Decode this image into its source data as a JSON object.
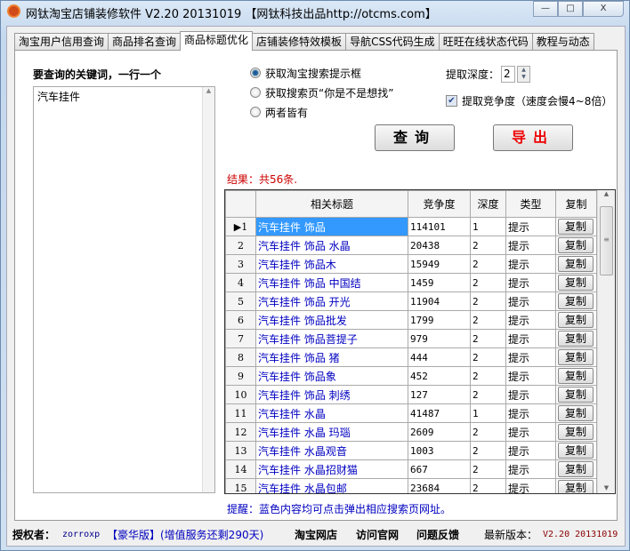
{
  "window": {
    "title": "网钛淘宝店铺装修软件 V2.20 20131019 【网钛科技出品http://otcms.com】",
    "min": "—",
    "max": "□",
    "close": "X"
  },
  "tabs": [
    "淘宝用户信用查询",
    "商品排名查询",
    "商品标题优化",
    "店铺装修特效模板",
    "导航CSS代码生成",
    "旺旺在线状态代码",
    "教程与动态"
  ],
  "left": {
    "label": "要查询的关键词，一行一个",
    "value": "汽车挂件"
  },
  "options": {
    "radios": [
      "获取淘宝搜索提示框",
      "获取搜索页“你是不是想找”",
      "两者皆有"
    ],
    "selected": 0,
    "depth_label": "提取深度：",
    "depth": "2",
    "check_label": "提取竞争度（速度会慢4~8倍）",
    "checked": true
  },
  "buttons": {
    "query": "查询",
    "export": "导出"
  },
  "result": "结果：共56条.",
  "grid": {
    "headers": [
      "相关标题",
      "竞争度",
      "深度",
      "类型",
      "复制"
    ],
    "rows": [
      {
        "n": "1",
        "title": "汽车挂件 饰品",
        "comp": "114101",
        "depth": "1",
        "type": "提示",
        "copy": "复制"
      },
      {
        "n": "2",
        "title": "汽车挂件 饰品 水晶",
        "comp": "20438",
        "depth": "2",
        "type": "提示",
        "copy": "复制"
      },
      {
        "n": "3",
        "title": "汽车挂件 饰品木",
        "comp": "15949",
        "depth": "2",
        "type": "提示",
        "copy": "复制"
      },
      {
        "n": "4",
        "title": "汽车挂件 饰品 中国结",
        "comp": "1459",
        "depth": "2",
        "type": "提示",
        "copy": "复制"
      },
      {
        "n": "5",
        "title": "汽车挂件 饰品 开光",
        "comp": "11904",
        "depth": "2",
        "type": "提示",
        "copy": "复制"
      },
      {
        "n": "6",
        "title": "汽车挂件 饰品批发",
        "comp": "1799",
        "depth": "2",
        "type": "提示",
        "copy": "复制"
      },
      {
        "n": "7",
        "title": "汽车挂件 饰品菩提子",
        "comp": "979",
        "depth": "2",
        "type": "提示",
        "copy": "复制"
      },
      {
        "n": "8",
        "title": "汽车挂件 饰品 猪",
        "comp": "444",
        "depth": "2",
        "type": "提示",
        "copy": "复制"
      },
      {
        "n": "9",
        "title": "汽车挂件 饰品象",
        "comp": "452",
        "depth": "2",
        "type": "提示",
        "copy": "复制"
      },
      {
        "n": "10",
        "title": "汽车挂件 饰品 刺绣",
        "comp": "127",
        "depth": "2",
        "type": "提示",
        "copy": "复制"
      },
      {
        "n": "11",
        "title": "汽车挂件 水晶",
        "comp": "41487",
        "depth": "1",
        "type": "提示",
        "copy": "复制"
      },
      {
        "n": "12",
        "title": "汽车挂件 水晶 玛瑙",
        "comp": "2609",
        "depth": "2",
        "type": "提示",
        "copy": "复制"
      },
      {
        "n": "13",
        "title": "汽车挂件 水晶观音",
        "comp": "1003",
        "depth": "2",
        "type": "提示",
        "copy": "复制"
      },
      {
        "n": "14",
        "title": "汽车挂件 水晶招财猫",
        "comp": "667",
        "depth": "2",
        "type": "提示",
        "copy": "复制"
      },
      {
        "n": "15",
        "title": "汽车挂件 水晶包邮",
        "comp": "23684",
        "depth": "2",
        "type": "提示",
        "copy": "复制"
      }
    ]
  },
  "hint": "提醒：蓝色内容均可点击弹出相应搜索页网址。",
  "footer": {
    "auth_label": "授权者：",
    "user": "zorroxp",
    "edition": "【豪华版】(增值服务还剩290天)",
    "links": [
      "淘宝网店",
      "访问官网",
      "问题反馈"
    ],
    "latest_label": "最新版本：",
    "latest": "V2.20 20131019"
  }
}
